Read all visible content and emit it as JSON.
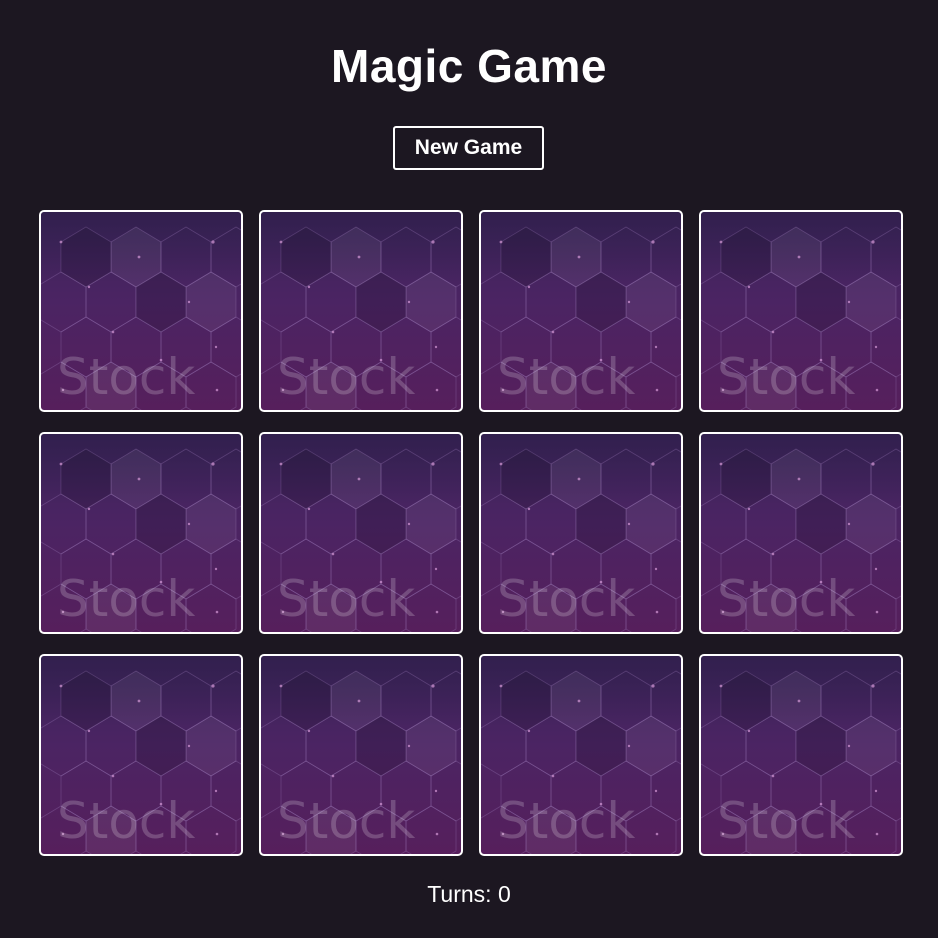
{
  "app": {
    "title": "Magic Game",
    "new_game_label": "New Game",
    "turns_label": "Turns:",
    "turns_value": "0"
  },
  "cards": [
    {
      "watermark": "Stock",
      "face": "down"
    },
    {
      "watermark": "Stock",
      "face": "down"
    },
    {
      "watermark": "Stock",
      "face": "down"
    },
    {
      "watermark": "Stock",
      "face": "down"
    },
    {
      "watermark": "Stock",
      "face": "down"
    },
    {
      "watermark": "Stock",
      "face": "down"
    },
    {
      "watermark": "Stock",
      "face": "down"
    },
    {
      "watermark": "Stock",
      "face": "down"
    },
    {
      "watermark": "Stock",
      "face": "down"
    },
    {
      "watermark": "Stock",
      "face": "down"
    },
    {
      "watermark": "Stock",
      "face": "down"
    },
    {
      "watermark": "Stock",
      "face": "down"
    }
  ],
  "colors": {
    "background": "#1c1721",
    "card_back_top": "#3b2459",
    "card_back_bottom": "#561f5c",
    "border": "#ffffff",
    "text": "#ffffff"
  },
  "icons": {
    "card_back_pattern": "hexagon-pattern-icon"
  }
}
